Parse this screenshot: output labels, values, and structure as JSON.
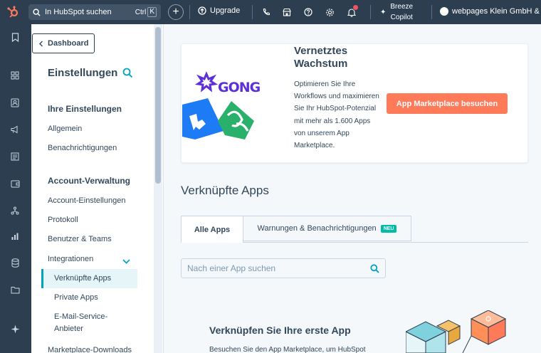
{
  "topbar": {
    "search_placeholder": "In HubSpot suchen",
    "shortcut_ctrl": "Ctrl",
    "shortcut_key": "K",
    "upgrade_label": "Upgrade",
    "breeze_line1": "Breeze",
    "breeze_line2": "Copilot",
    "account_name": "webpages Klein GmbH & C"
  },
  "sidebar": {
    "back_label": "Dashboard",
    "title": "Einstellungen",
    "section_personal": "Ihre Einstellungen",
    "item_general": "Allgemein",
    "item_notifications": "Benachrichtigungen",
    "section_account": "Account-Verwaltung",
    "item_account_settings": "Account-Einstellungen",
    "item_log": "Protokoll",
    "item_users_teams": "Benutzer & Teams",
    "item_integrations": "Integrationen",
    "sub_connected_apps": "Verknüpfte Apps",
    "sub_private_apps": "Private Apps",
    "sub_email_provider_1": "E-Mail-Service-",
    "sub_email_provider_2": "Anbieter",
    "item_marketplace_downloads": "Marketplace-Downloads"
  },
  "promo": {
    "title_line1": "Vernetztes",
    "title_line2": "Wachstum",
    "text": "Optimieren Sie Ihre Workflows und maximieren Sie Ihr HubSpot-Potenzial mit mehr als 1.600 Apps von unserem App Marketplace.",
    "button_label": "App Marketplace besuchen",
    "gong_logo": "GONG"
  },
  "main": {
    "section_title": "Verknüpfte Apps",
    "tab_all": "Alle Apps",
    "tab_warnings": "Warnungen & Benachrichtigungen",
    "tab_warnings_badge": "NEU",
    "search_placeholder": "Nach einer App suchen",
    "empty_title": "Verknüpfen Sie Ihre erste App",
    "empty_text": "Besuchen Sie den App Marketplace, um HubSpot"
  },
  "colors": {
    "nav_bg": "#2d3e50",
    "accent_teal": "#00a4bd",
    "button_orange": "#ff7a59",
    "badge_green": "#00bda5"
  }
}
